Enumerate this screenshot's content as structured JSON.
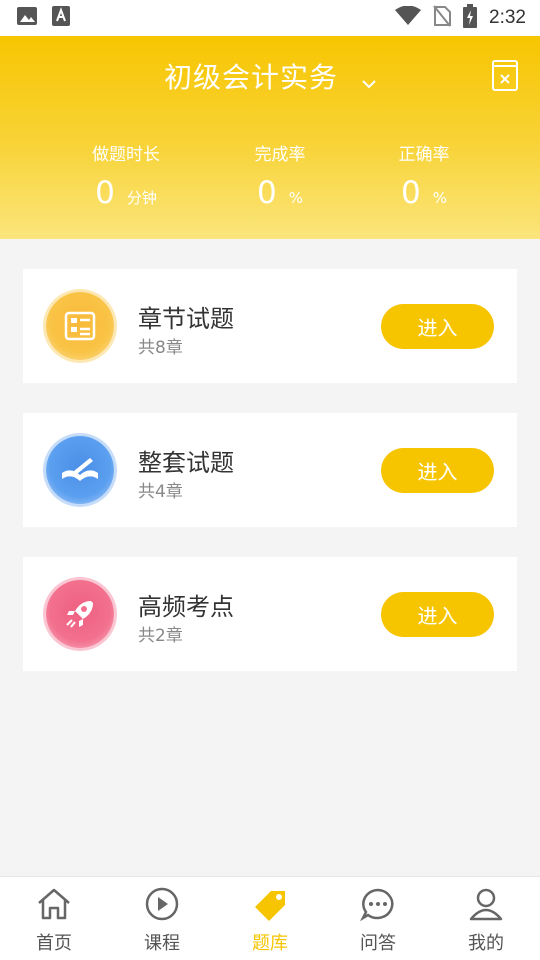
{
  "status_bar": {
    "time": "2:32",
    "icons": [
      "image-icon",
      "font-icon",
      "wifi-icon",
      "no-sim-icon",
      "battery-charging-icon"
    ]
  },
  "header": {
    "title": "初级会计实务",
    "stats": [
      {
        "label": "做题时长",
        "value": "0",
        "unit": "分钟"
      },
      {
        "label": "完成率",
        "value": "0",
        "unit": "%"
      },
      {
        "label": "正确率",
        "value": "0",
        "unit": "%"
      }
    ]
  },
  "cards": [
    {
      "title": "章节试题",
      "subtitle": "共8章",
      "button": "进入",
      "icon": "chapter-list-icon"
    },
    {
      "title": "整套试题",
      "subtitle": "共4章",
      "button": "进入",
      "icon": "open-book-pen-icon"
    },
    {
      "title": "高频考点",
      "subtitle": "共2章",
      "button": "进入",
      "icon": "rocket-icon"
    }
  ],
  "tabbar": {
    "items": [
      {
        "label": "首页",
        "icon": "home-icon",
        "active": false
      },
      {
        "label": "课程",
        "icon": "play-icon",
        "active": false
      },
      {
        "label": "题库",
        "icon": "tag-icon",
        "active": true
      },
      {
        "label": "问答",
        "icon": "chat-icon",
        "active": false
      },
      {
        "label": "我的",
        "icon": "user-icon",
        "active": false
      }
    ]
  },
  "colors": {
    "accent": "#f7c500",
    "card_icon_1": "#f9c447",
    "card_icon_2": "#5b9ff0",
    "card_icon_3": "#f2708e"
  }
}
